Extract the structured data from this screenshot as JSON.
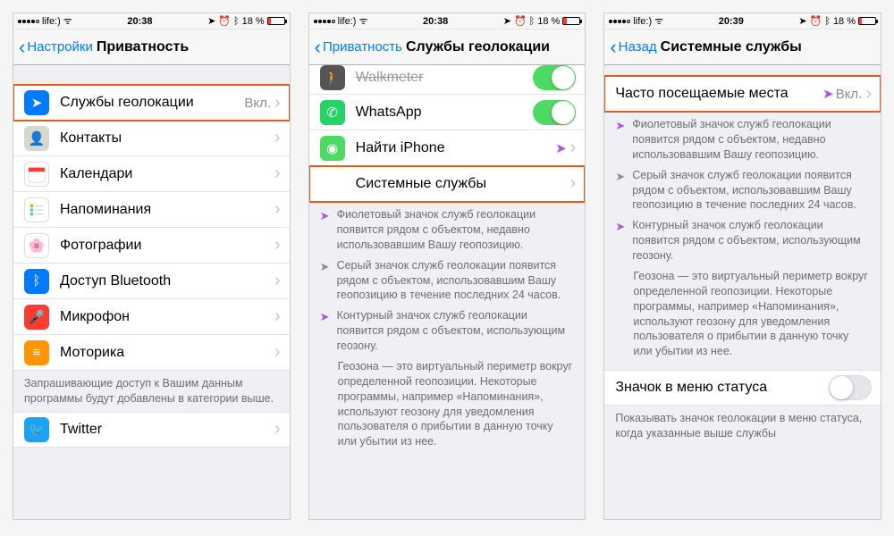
{
  "statusbar": {
    "carrier": "life:)",
    "time1": "20:38",
    "time2": "20:38",
    "time3": "20:39",
    "battery": "18 %"
  },
  "screen1": {
    "back": "Настройки",
    "title": "Приватность",
    "rows": {
      "location": {
        "label": "Службы геолокации",
        "value": "Вкл."
      },
      "contacts": "Контакты",
      "calendars": "Календари",
      "reminders": "Напоминания",
      "photos": "Фотографии",
      "bluetooth": "Доступ Bluetooth",
      "mic": "Микрофон",
      "motion": "Моторика",
      "twitter": "Twitter"
    },
    "footer": "Запрашивающие доступ к Вашим данным программы будут добавлены в категории выше."
  },
  "screen2": {
    "back": "Приватность",
    "title": "Службы геолокации",
    "rows": {
      "walkmeter": "Walkmeter",
      "whatsapp": "WhatsApp",
      "findiphone": "Найти iPhone",
      "system": "Системные службы"
    },
    "info": {
      "purple": "Фиолетовый значок служб геолокации появится рядом с объектом, недавно использовавшим Вашу геопозицию.",
      "gray": "Серый значок служб геолокации появится рядом с объектом, использовавшим Вашу геопозицию в течение последних 24 часов.",
      "outline": "Контурный значок служб геолокации появится рядом с объектом, использующим геозону.",
      "geofence": "Геозона — это виртуальный периметр вокруг определенной геопозиции. Некоторые программы, например «Напоминания», используют геозону для уведомления пользователя о прибытии в данную точку или убытии из нее."
    }
  },
  "screen3": {
    "back": "Назад",
    "title": "Системные службы",
    "rows": {
      "frequent": {
        "label": "Часто посещаемые места",
        "value": "Вкл."
      },
      "statusicon": "Значок в меню статуса"
    },
    "info": {
      "purple": "Фиолетовый значок служб геолокации появится рядом с объектом, недавно использовавшим Вашу геопозицию.",
      "gray": "Серый значок служб геолокации появится рядом с объектом, использовавшим Вашу геопозицию в течение последних 24 часов.",
      "outline": "Контурный значок служб геолокации появится рядом с объектом, использующим геозону.",
      "geofence": "Геозона — это виртуальный периметр вокруг определенной геопозиции. Некоторые программы, например «Напоминания», используют геозону для уведомления пользователя о прибытии в данную точку или убытии из нее."
    },
    "footer2": "Показывать значок геолокации в меню статуса, когда указанные выше службы"
  }
}
